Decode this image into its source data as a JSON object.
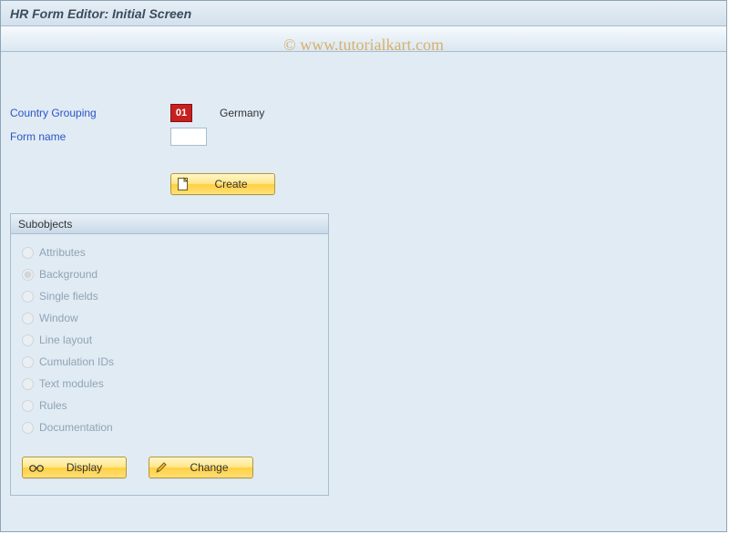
{
  "header": {
    "title": "HR Form Editor: Initial Screen"
  },
  "watermark": "© www.tutorialkart.com",
  "fields": {
    "country_grouping": {
      "label": "Country Grouping",
      "value": "01",
      "display": "Germany"
    },
    "form_name": {
      "label": "Form name",
      "value": ""
    }
  },
  "buttons": {
    "create": "Create",
    "display": "Display",
    "change": "Change"
  },
  "subobjects": {
    "title": "Subobjects",
    "selected": "Background",
    "items": [
      {
        "label": "Attributes"
      },
      {
        "label": "Background"
      },
      {
        "label": "Single fields"
      },
      {
        "label": "Window"
      },
      {
        "label": "Line layout"
      },
      {
        "label": "Cumulation IDs"
      },
      {
        "label": "Text modules"
      },
      {
        "label": "Rules"
      },
      {
        "label": "Documentation"
      }
    ]
  }
}
